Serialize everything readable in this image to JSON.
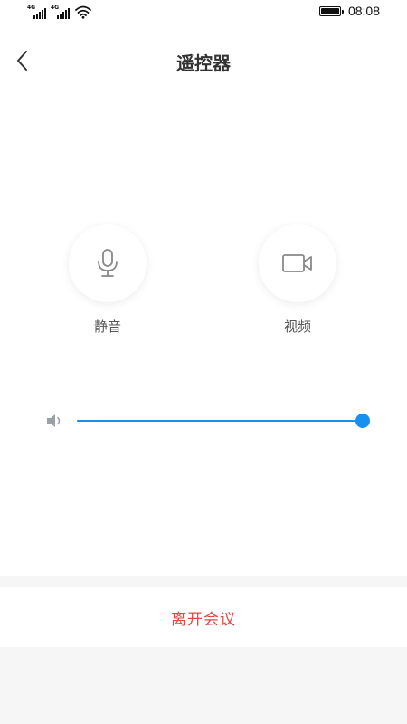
{
  "status_bar": {
    "network_1": "4G",
    "network_2": "4G",
    "time": "08:08",
    "battery_level": 100
  },
  "header": {
    "title": "遥控器",
    "back_icon": "chevron-left-icon"
  },
  "controls": {
    "mute": {
      "label": "静音",
      "icon": "microphone-icon"
    },
    "video": {
      "label": "视频",
      "icon": "video-camera-icon"
    }
  },
  "volume": {
    "icon": "speaker-icon",
    "level": 100
  },
  "footer": {
    "leave_label": "离开会议"
  },
  "colors": {
    "accent": "#1890f0",
    "danger": "#e04848",
    "title": "#333333",
    "label": "#555555",
    "icon": "#888888",
    "background_gray": "#f6f6f6"
  }
}
